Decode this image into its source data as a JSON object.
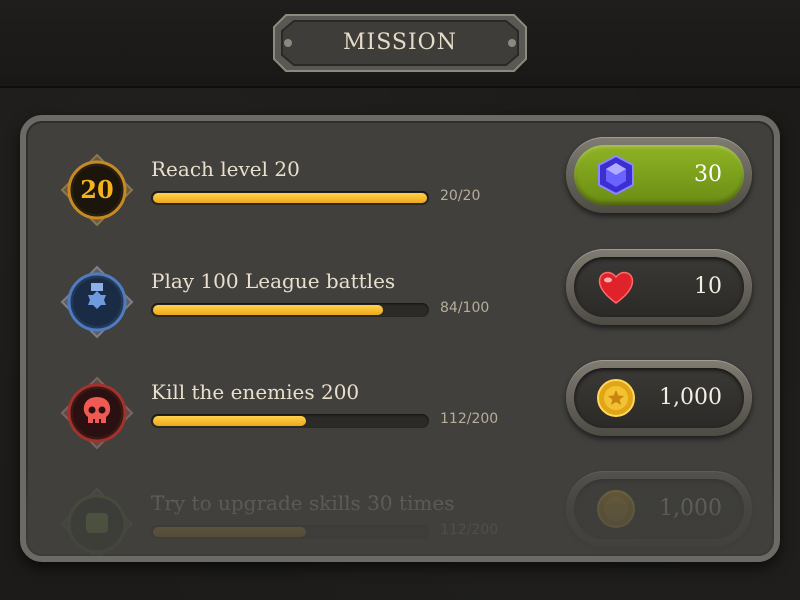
{
  "header": {
    "title": "MISSION"
  },
  "missions": [
    {
      "badge_text": "20",
      "badge_icon": "level-badge-icon",
      "title": "Reach level 20",
      "progress": 1.0,
      "progress_text": "20/20",
      "reward_icon": "gem-icon",
      "reward_value": "30",
      "claimable": true
    },
    {
      "badge_icon": "medal-icon",
      "title": "Play 100 League battles",
      "progress": 0.84,
      "progress_text": "84/100",
      "reward_icon": "heart-icon",
      "reward_value": "10",
      "claimable": false
    },
    {
      "badge_icon": "skull-icon",
      "title": "Kill the enemies 200",
      "progress": 0.56,
      "progress_text": "112/200",
      "reward_icon": "coin-icon",
      "reward_value": "1,000",
      "claimable": false
    },
    {
      "badge_icon": "fist-icon",
      "title": "Try to upgrade skills 30 times",
      "progress": 0.56,
      "progress_text": "112/200",
      "reward_icon": "coin-icon",
      "reward_value": "1,000",
      "claimable": false
    }
  ],
  "colors": {
    "accent_gold": "#f5b21e",
    "progress_fill": "#ffd24c",
    "claim_green": "#8fb324",
    "panel": "#41403d"
  }
}
